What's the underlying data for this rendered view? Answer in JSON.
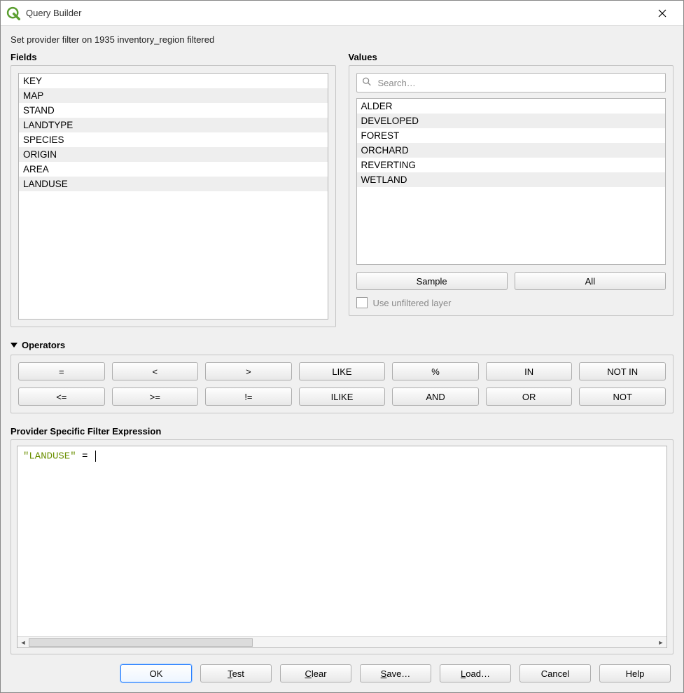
{
  "window": {
    "title": "Query Builder"
  },
  "status": "Set provider filter on 1935 inventory_region filtered",
  "fields": {
    "label": "Fields",
    "items": [
      "KEY",
      "MAP",
      "STAND",
      "LANDTYPE",
      "SPECIES",
      "ORIGIN",
      "AREA",
      "LANDUSE"
    ]
  },
  "values": {
    "label": "Values",
    "search_placeholder": "Search…",
    "items": [
      "ALDER",
      "DEVELOPED",
      "FOREST",
      "ORCHARD",
      "REVERTING",
      "WETLAND"
    ],
    "sample_label": "Sample",
    "all_label": "All",
    "unfiltered_label": "Use unfiltered layer"
  },
  "operators": {
    "label": "Operators",
    "row1": [
      "=",
      "<",
      ">",
      "LIKE",
      "%",
      "IN",
      "NOT IN"
    ],
    "row2": [
      "<=",
      ">=",
      "!=",
      "ILIKE",
      "AND",
      "OR",
      "NOT"
    ]
  },
  "expression": {
    "label": "Provider Specific Filter Expression",
    "quoted": "\"LANDUSE\"",
    "rest": " = "
  },
  "footer": {
    "ok": "OK",
    "test": "Test",
    "clear": "Clear",
    "save": "Save…",
    "load": "Load…",
    "cancel": "Cancel",
    "help": "Help"
  }
}
